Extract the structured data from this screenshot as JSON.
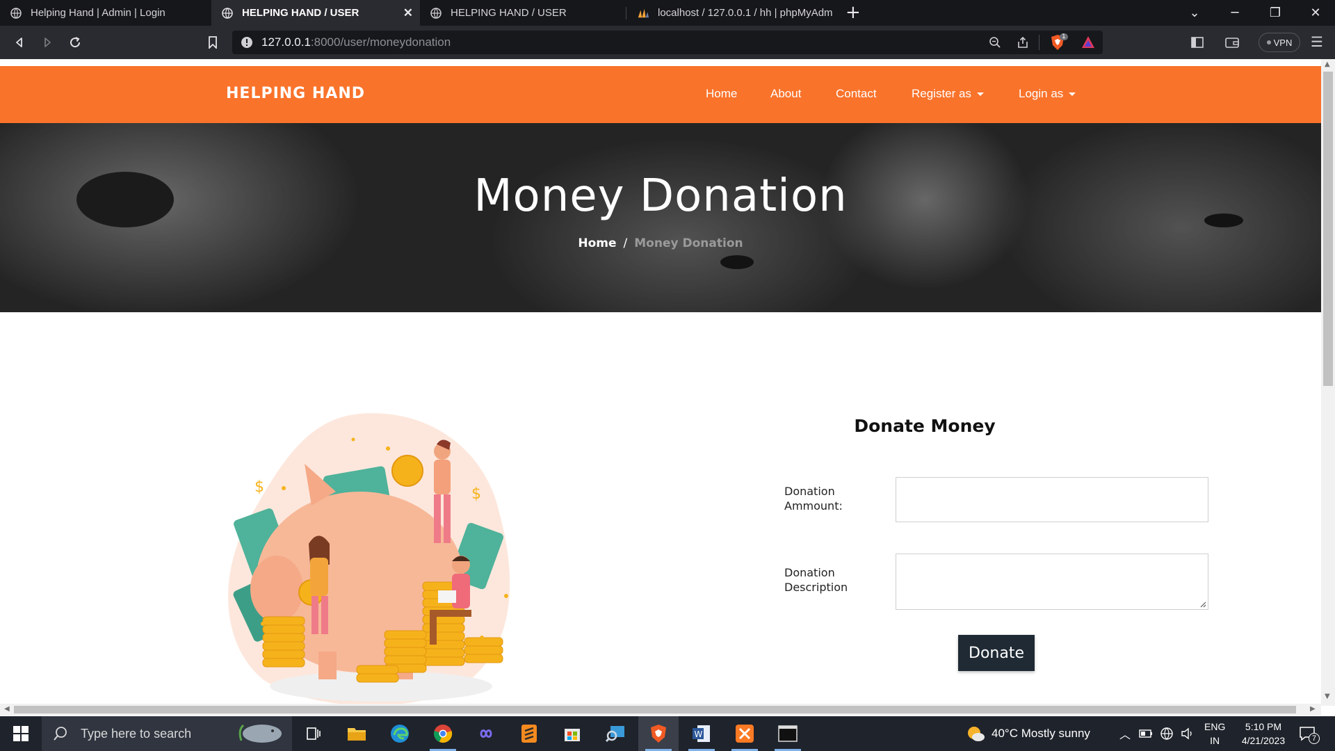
{
  "browser": {
    "tabs": [
      {
        "title": "Helping Hand | Admin | Login",
        "active": false
      },
      {
        "title": "HELPING HAND / USER",
        "active": true
      },
      {
        "title": "HELPING HAND / USER",
        "active": false
      },
      {
        "title": "localhost / 127.0.0.1 / hh | phpMyAdm",
        "active": false
      }
    ],
    "url_host": "127.0.0.1",
    "url_rest": ":8000/user/moneydonation",
    "shield_count": "1",
    "vpn_label": "VPN"
  },
  "site": {
    "brand": "HELPING HAND",
    "nav": {
      "home": "Home",
      "about": "About",
      "contact": "Contact",
      "register": "Register as",
      "login": "Login as"
    },
    "accent_color": "#f9732b"
  },
  "hero": {
    "title": "Money Donation",
    "breadcrumb_home": "Home",
    "breadcrumb_sep": "/",
    "breadcrumb_current": "Money Donation"
  },
  "form": {
    "title": "Donate Money",
    "amount_label_line1": "Donation",
    "amount_label_line2": "Ammount:",
    "amount_value": "",
    "description_label_line1": "Donation",
    "description_label_line2": "Description",
    "description_value": "",
    "submit_label": "Donate"
  },
  "taskbar": {
    "search_placeholder": "Type here to search",
    "weather": "40°C  Mostly sunny",
    "lang_line1": "ENG",
    "lang_line2": "IN",
    "time": "5:10 PM",
    "date": "4/21/2023",
    "notifications": "7"
  }
}
